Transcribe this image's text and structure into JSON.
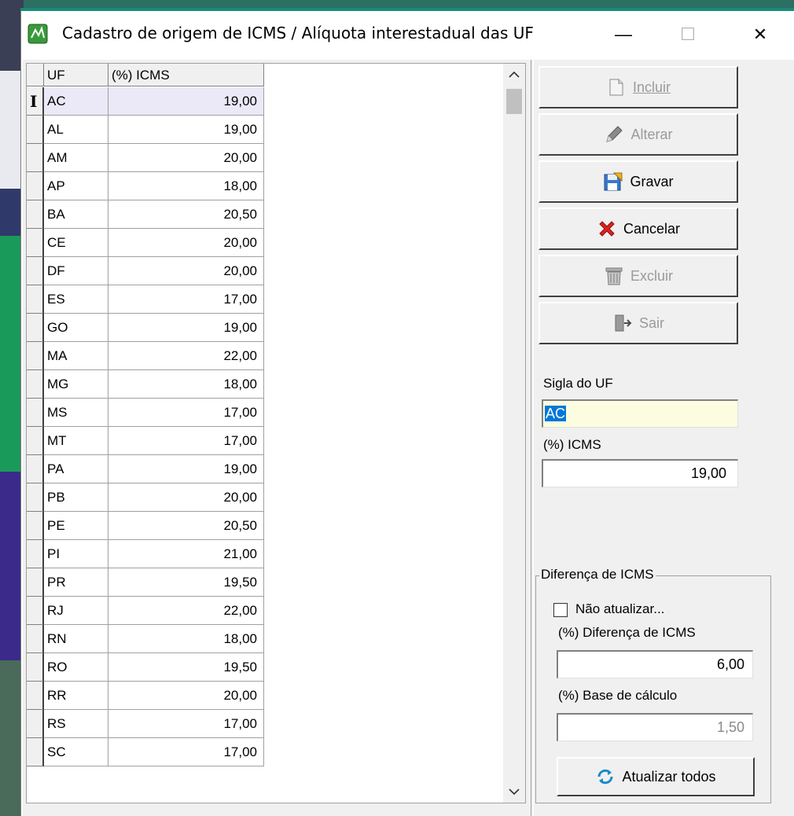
{
  "window": {
    "title": "Cadastro de origem de ICMS / Alíquota interestadual das UF",
    "controls": {
      "minimize": "—",
      "maximize": "☐",
      "close": "✕"
    }
  },
  "grid": {
    "columns": [
      "UF",
      "(%) ICMS"
    ],
    "selected_index": 0,
    "rows": [
      {
        "uf": "AC",
        "icms": "19,00"
      },
      {
        "uf": "AL",
        "icms": "19,00"
      },
      {
        "uf": "AM",
        "icms": "20,00"
      },
      {
        "uf": "AP",
        "icms": "18,00"
      },
      {
        "uf": "BA",
        "icms": "20,50"
      },
      {
        "uf": "CE",
        "icms": "20,00"
      },
      {
        "uf": "DF",
        "icms": "20,00"
      },
      {
        "uf": "ES",
        "icms": "17,00"
      },
      {
        "uf": "GO",
        "icms": "19,00"
      },
      {
        "uf": "MA",
        "icms": "22,00"
      },
      {
        "uf": "MG",
        "icms": "18,00"
      },
      {
        "uf": "MS",
        "icms": "17,00"
      },
      {
        "uf": "MT",
        "icms": "17,00"
      },
      {
        "uf": "PA",
        "icms": "19,00"
      },
      {
        "uf": "PB",
        "icms": "20,00"
      },
      {
        "uf": "PE",
        "icms": "20,50"
      },
      {
        "uf": "PI",
        "icms": "21,00"
      },
      {
        "uf": "PR",
        "icms": "19,50"
      },
      {
        "uf": "RJ",
        "icms": "22,00"
      },
      {
        "uf": "RN",
        "icms": "18,00"
      },
      {
        "uf": "RO",
        "icms": "19,50"
      },
      {
        "uf": "RR",
        "icms": "20,00"
      },
      {
        "uf": "RS",
        "icms": "17,00"
      },
      {
        "uf": "SC",
        "icms": "17,00"
      }
    ]
  },
  "buttons": {
    "incluir": "Incluir",
    "alterar": "Alterar",
    "gravar": "Gravar",
    "cancelar": "Cancelar",
    "excluir": "Excluir",
    "sair": "Sair",
    "atualizar_todos": "Atualizar todos"
  },
  "form": {
    "sigla_label": "Sigla do UF",
    "sigla_value": "AC",
    "icms_label": "(%) ICMS",
    "icms_value": "19,00"
  },
  "diferenca": {
    "legend": "Diferença de ICMS",
    "nao_atualizar_label": "Não atualizar...",
    "nao_atualizar_checked": false,
    "diferenca_label": "(%) Diferença de ICMS",
    "diferenca_value": "6,00",
    "base_label": "(%) Base de cálculo",
    "base_value": "1,50"
  },
  "colors": {
    "selection": "#0078d7",
    "sigla_bg": "#fcfce0",
    "selected_row": "#ebe9f8"
  }
}
